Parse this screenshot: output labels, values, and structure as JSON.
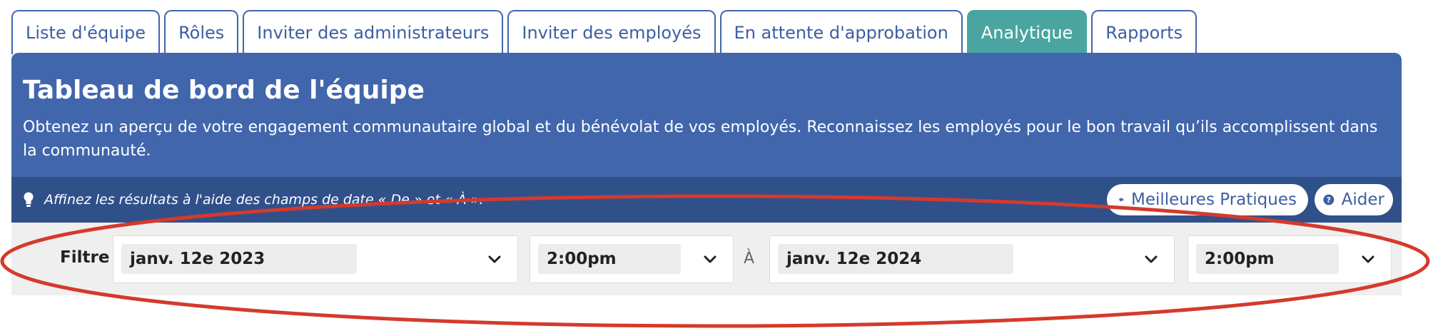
{
  "tabs": [
    {
      "label": "Liste d'équipe",
      "active": false
    },
    {
      "label": "Rôles",
      "active": false
    },
    {
      "label": "Inviter des administrateurs",
      "active": false
    },
    {
      "label": "Inviter des employés",
      "active": false
    },
    {
      "label": "En attente d'approbation",
      "active": false
    },
    {
      "label": "Analytique",
      "active": true
    },
    {
      "label": "Rapports",
      "active": false
    }
  ],
  "header": {
    "title": "Tableau de bord de l'équipe",
    "description": "Obtenez un aperçu de votre engagement communautaire global et du bénévolat de vos employés. Reconnaissez les employés pour le bon travail qu’ils accomplissent dans la communauté."
  },
  "hint_bar": {
    "hint": "Affinez les résultats à l'aide des champs de date « De » et « À ».",
    "best_practices_label": "Meilleures Pratiques",
    "help_label": "Aider"
  },
  "filter": {
    "label": "Filtre",
    "from_date": "janv. 12e 2023",
    "from_time": "2:00pm",
    "to_label": "À",
    "to_date": "janv. 12e 2024",
    "to_time": "2:00pm"
  },
  "colors": {
    "primary": "#4166ac",
    "primary_dark": "#30508a",
    "tab_active": "#4aa5a0",
    "filter_bg": "#efefef",
    "annotation": "#d43a2c"
  },
  "icons": [
    "lightbulb-icon",
    "graduation-cap-icon",
    "question-circle-icon",
    "chevron-down-icon"
  ]
}
